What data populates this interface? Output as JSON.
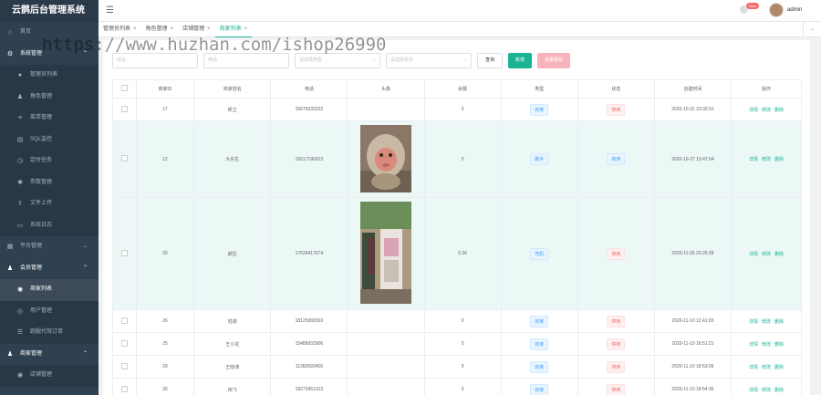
{
  "app_title": "云鹊后台管理系统",
  "sidebar": {
    "items": [
      {
        "label": "首页",
        "icon": "home-icon",
        "level": "top"
      },
      {
        "label": "系统管理",
        "icon": "gear-icon",
        "level": "top",
        "expanded": true
      },
      {
        "label": "管理员列表",
        "icon": "user-icon",
        "level": "sub"
      },
      {
        "label": "角色管理",
        "icon": "role-icon",
        "level": "sub"
      },
      {
        "label": "菜单管理",
        "icon": "menu-icon",
        "level": "sub"
      },
      {
        "label": "SQL监控",
        "icon": "database-icon",
        "level": "sub"
      },
      {
        "label": "定时任务",
        "icon": "clock-icon",
        "level": "sub"
      },
      {
        "label": "参数管理",
        "icon": "settings-icon",
        "level": "sub"
      },
      {
        "label": "文件上传",
        "icon": "upload-icon",
        "level": "sub"
      },
      {
        "label": "系统日志",
        "icon": "log-icon",
        "level": "sub"
      },
      {
        "label": "平台管理",
        "icon": "platform-icon",
        "level": "top"
      },
      {
        "label": "会员管理",
        "icon": "member-icon",
        "level": "top",
        "expanded": true
      },
      {
        "label": "商家列表",
        "icon": "shop-icon",
        "level": "sub",
        "active": true
      },
      {
        "label": "用户管理",
        "icon": "users-icon",
        "level": "sub"
      },
      {
        "label": "跑腿代驾订单",
        "icon": "order-icon",
        "level": "sub"
      },
      {
        "label": "商家管理",
        "icon": "store-icon",
        "level": "top",
        "expanded": true
      },
      {
        "label": "店铺管理",
        "icon": "shop-icon",
        "level": "sub"
      }
    ]
  },
  "header": {
    "badge": "New",
    "username": "admin"
  },
  "tabs": [
    {
      "label": "管理员列表",
      "active": false
    },
    {
      "label": "角色管理",
      "active": false
    },
    {
      "label": "店铺管理",
      "active": false
    },
    {
      "label": "商家列表",
      "active": true
    }
  ],
  "filters": {
    "name_placeholder": "姓名",
    "phone_placeholder": "电话",
    "type_placeholder": "请选择类型",
    "status_placeholder": "请选择状态",
    "search_label": "查询",
    "add_label": "新增",
    "batch_delete_label": "批量删除"
  },
  "watermark": "https://www.huzhan.com/ishop26990",
  "table": {
    "columns": [
      "商家ID",
      "商家姓名",
      "电话",
      "头像",
      "余额",
      "类型",
      "状态",
      "创建时间",
      "操作"
    ],
    "actions": [
      "详情",
      "修改",
      "删除"
    ],
    "rows": [
      {
        "id": "17",
        "name": "侯立",
        "phone": "15679333222",
        "avatar": "",
        "balance": "0",
        "type": "商家",
        "status": "停用",
        "created": "2020-10-31 23:32:51"
      },
      {
        "id": "12",
        "name": "大先生",
        "phone": "15617190913",
        "avatar": "monkey",
        "balance": "0",
        "type": "跑手",
        "status": "启用",
        "created": "2020-10-27 15:47:54"
      },
      {
        "id": "20",
        "name": "郝生",
        "phone": "17639417674",
        "avatar": "street",
        "balance": "0.36",
        "type": "司机",
        "status": "停用",
        "created": "2020-11-05 20:26:28"
      },
      {
        "id": "26",
        "name": "姓谢",
        "phone": "18125365503",
        "avatar": "",
        "balance": "0",
        "type": "商家",
        "status": "停用",
        "created": "2020-11-10 12:41:03"
      },
      {
        "id": "25",
        "name": "王小花",
        "phone": "15486933906",
        "avatar": "",
        "balance": "0",
        "type": "商家",
        "status": "停用",
        "created": "2020-11-10 16:51:21"
      },
      {
        "id": "29",
        "name": "王晓涛",
        "phone": "11360593456",
        "avatar": "",
        "balance": "0",
        "type": "商家",
        "status": "停用",
        "created": "2020-11-10 18:53:09"
      },
      {
        "id": "30",
        "name": "田飞",
        "phone": "18273451313",
        "avatar": "",
        "balance": "0",
        "type": "商家",
        "status": "停用",
        "created": "2020-11-10 18:54:36"
      }
    ]
  }
}
